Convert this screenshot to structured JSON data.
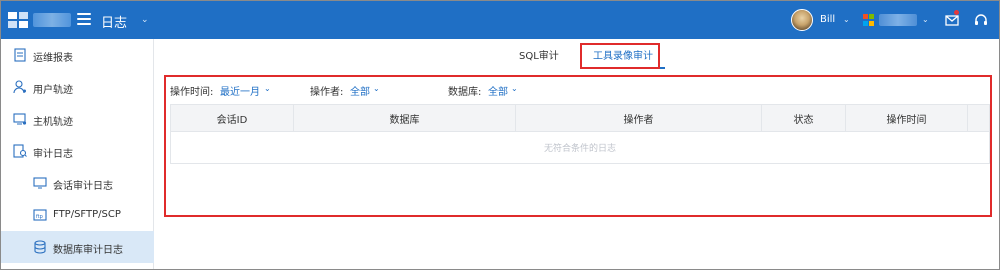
{
  "header": {
    "app_title": "日志",
    "user_name": "Bill",
    "icons": [
      "logo-icon",
      "menu-icon",
      "avatar",
      "windows-icon",
      "mail-icon",
      "headset-icon"
    ],
    "colors": {
      "bar": "#1f6fc5",
      "accent": "#1f6fc5",
      "highlight": "#e02b2b"
    }
  },
  "sidebar": {
    "items": [
      {
        "label": "运维报表",
        "icon": "report-icon"
      },
      {
        "label": "用户轨迹",
        "icon": "user-track-icon"
      },
      {
        "label": "主机轨迹",
        "icon": "host-track-icon"
      },
      {
        "label": "审计日志",
        "icon": "audit-log-icon"
      },
      {
        "label": "会话审计日志",
        "icon": "session-icon"
      },
      {
        "label": "FTP/SFTP/SCP",
        "icon": "ftp-icon"
      },
      {
        "label": "数据库审计日志",
        "icon": "database-icon",
        "active": true
      }
    ]
  },
  "tabs": [
    {
      "label": "SQL审计"
    },
    {
      "label": "工具录像审计",
      "active": true
    }
  ],
  "filters": {
    "time_label": "操作时间:",
    "time_value": "最近一月",
    "operator_label": "操作者:",
    "operator_value": "全部",
    "database_label": "数据库:",
    "database_value": "全部"
  },
  "table": {
    "columns": [
      "会话ID",
      "数据库",
      "操作者",
      "状态",
      "操作时间",
      ""
    ],
    "empty_text": "无符合条件的日志"
  }
}
